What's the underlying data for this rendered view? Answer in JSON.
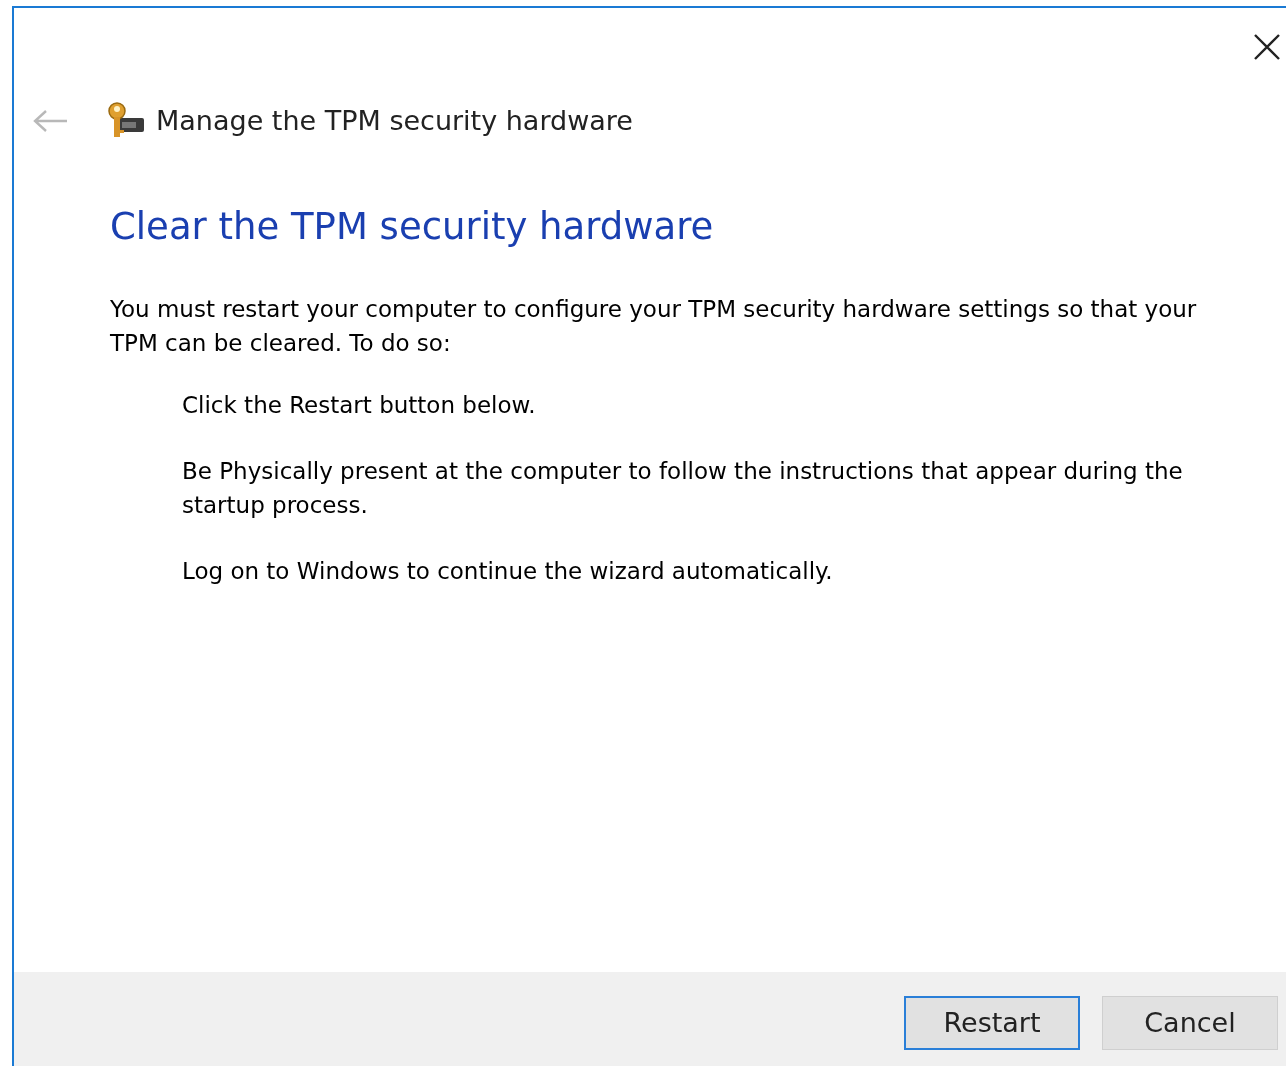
{
  "header": {
    "title": "Manage the TPM security hardware"
  },
  "heading": "Clear the TPM security hardware",
  "intro": "You must restart your computer to configure your TPM security hardware settings so that your TPM can be cleared. To do so:",
  "steps": [
    {
      "text": "Click the Restart button below."
    },
    {
      "text": "Be Physically present at the computer to follow the instructions that appear during the startup process."
    },
    {
      "text": "Log on to Windows to continue the wizard automatically."
    }
  ],
  "buttons": [
    {
      "label": "Restart",
      "focused": true
    },
    {
      "label": "Cancel",
      "focused": false
    }
  ]
}
